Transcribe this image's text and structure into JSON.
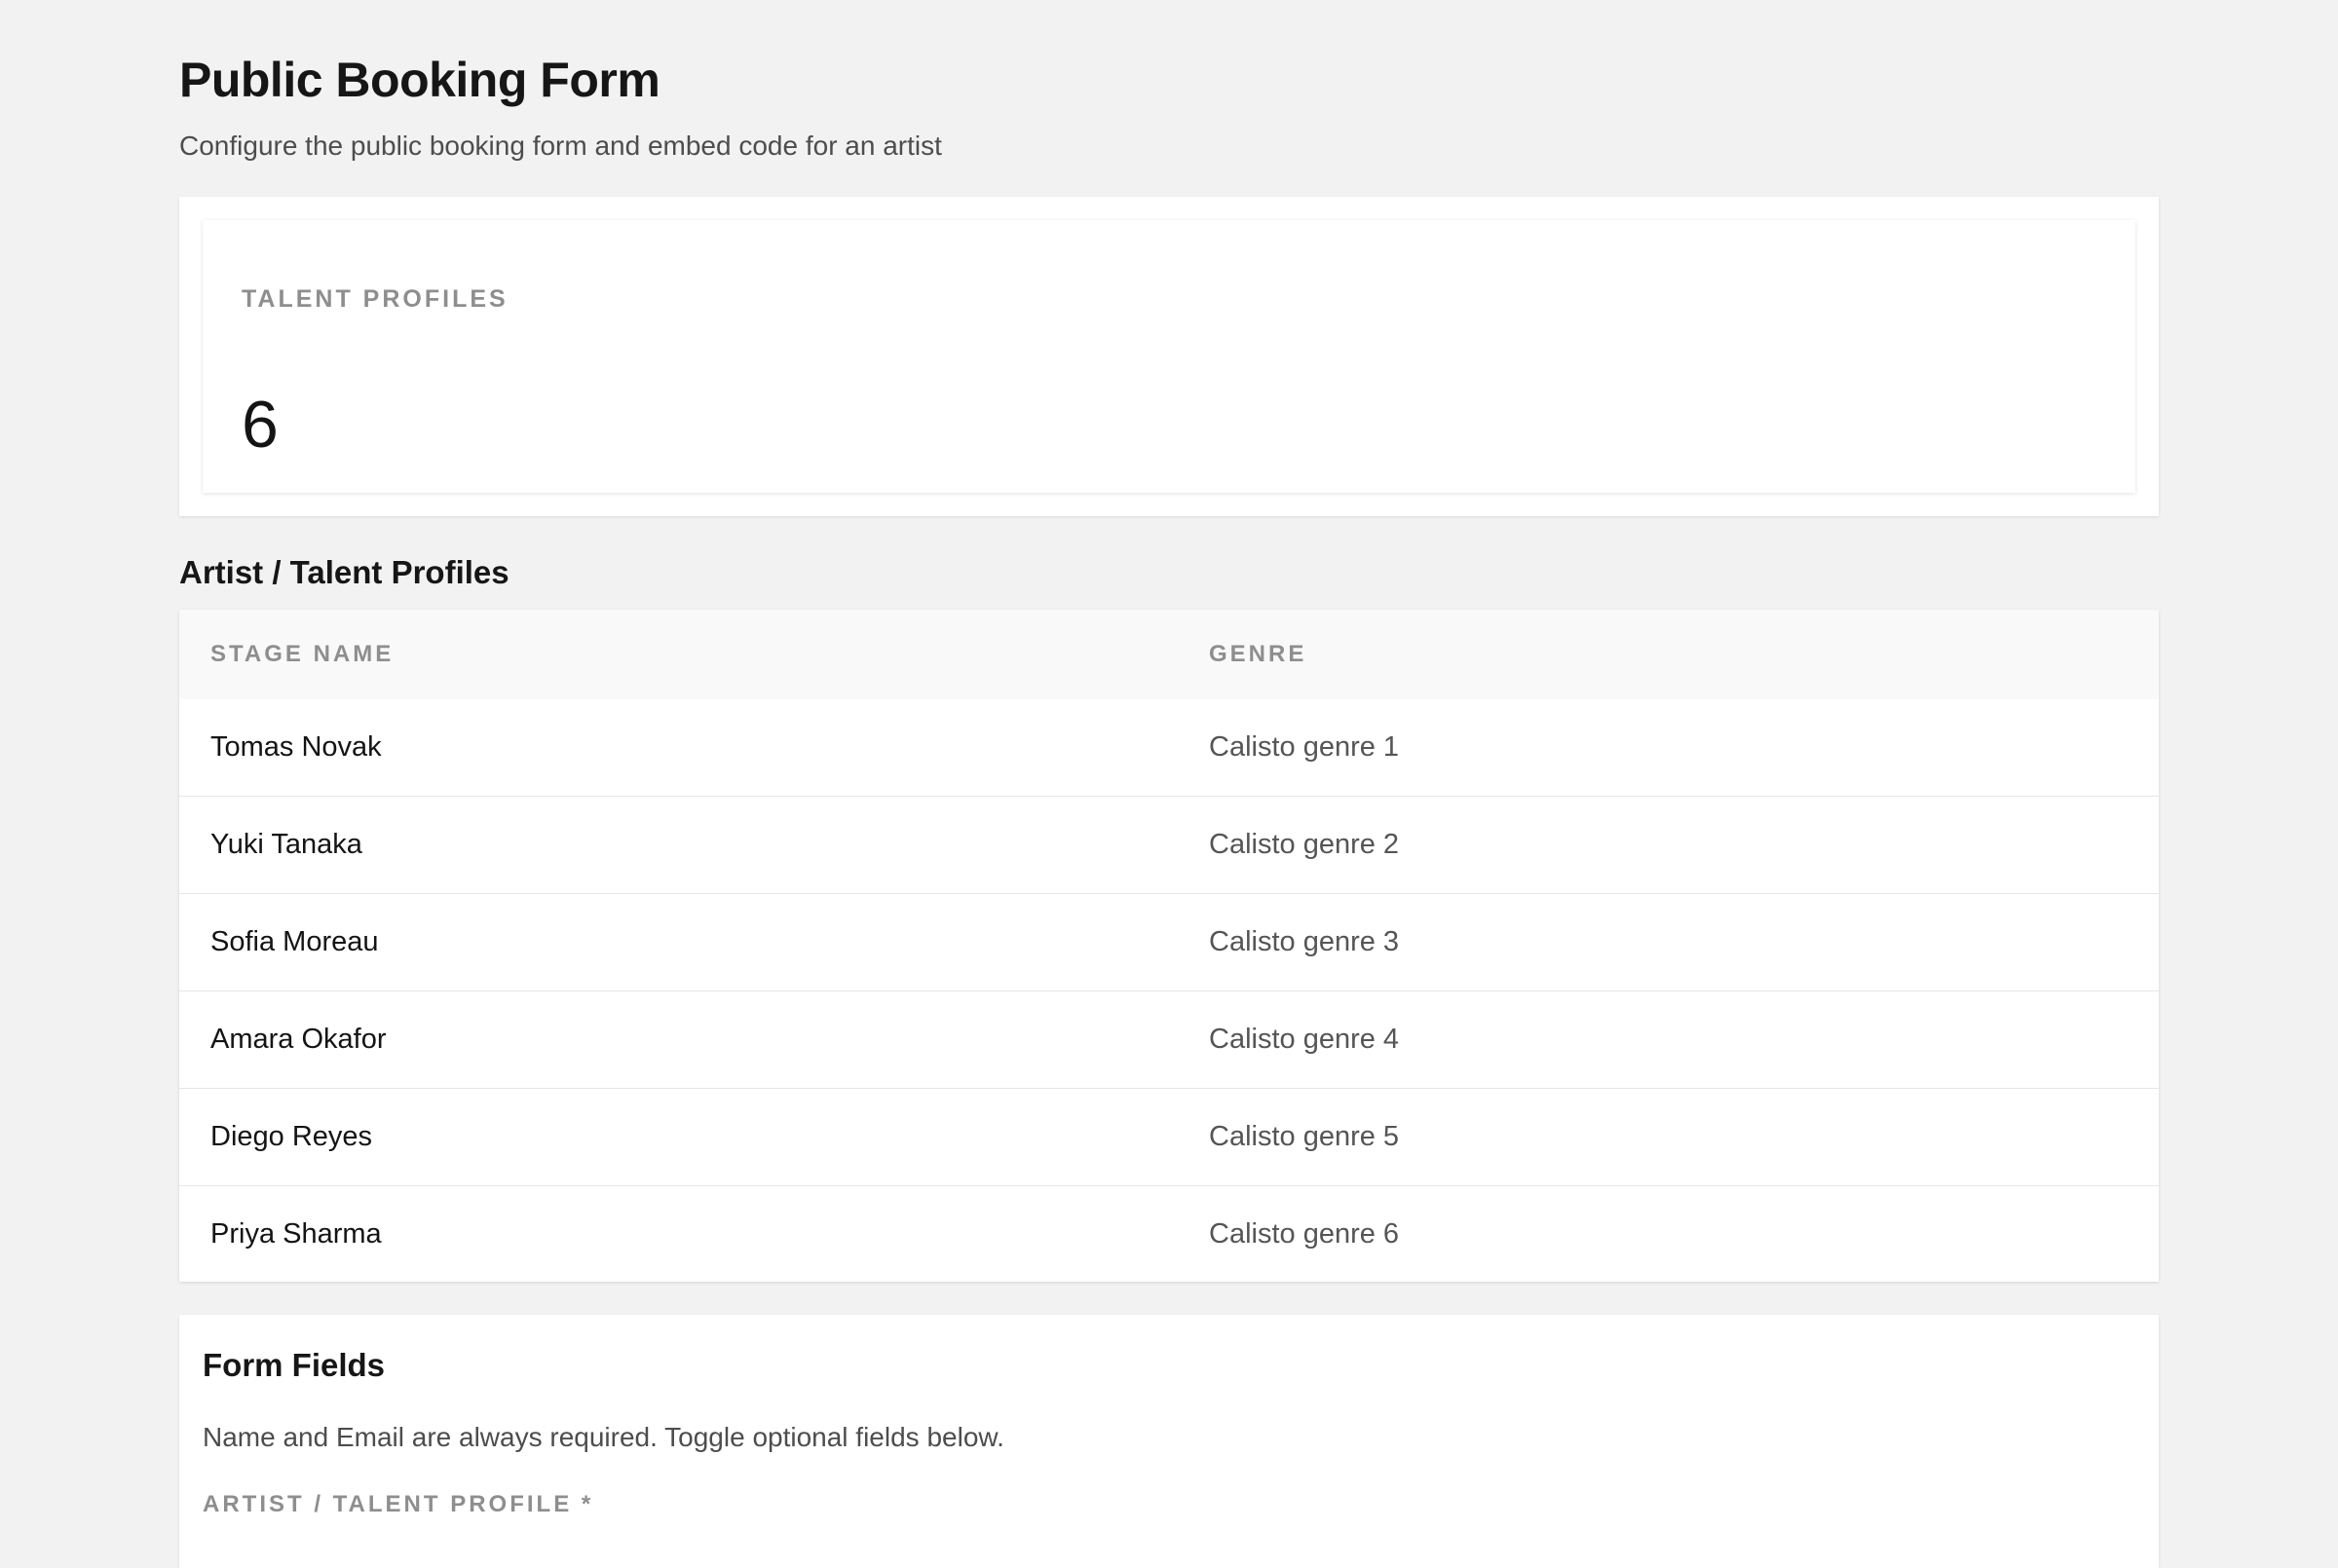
{
  "header": {
    "title": "Public Booking Form",
    "subtitle": "Configure the public booking form and embed code for an artist"
  },
  "stats": {
    "label": "TALENT PROFILES",
    "value": "6"
  },
  "profiles_section": {
    "title": "Artist / Talent Profiles",
    "columns": [
      "STAGE NAME",
      "GENRE"
    ],
    "rows": [
      {
        "stage_name": "Tomas Novak",
        "genre": "Calisto genre 1"
      },
      {
        "stage_name": "Yuki Tanaka",
        "genre": "Calisto genre 2"
      },
      {
        "stage_name": "Sofia Moreau",
        "genre": "Calisto genre 3"
      },
      {
        "stage_name": "Amara Okafor",
        "genre": "Calisto genre 4"
      },
      {
        "stage_name": "Diego Reyes",
        "genre": "Calisto genre 5"
      },
      {
        "stage_name": "Priya Sharma",
        "genre": "Calisto genre 6"
      }
    ]
  },
  "form_fields": {
    "title": "Form Fields",
    "description": "Name and Email are always required. Toggle optional fields below.",
    "artist_label": "ARTIST / TALENT PROFILE *"
  }
}
